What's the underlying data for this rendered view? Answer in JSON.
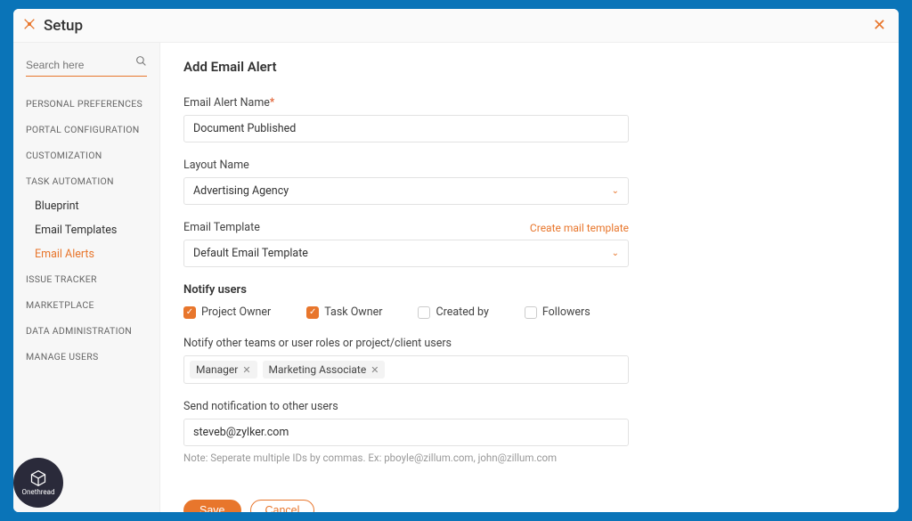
{
  "header": {
    "title": "Setup"
  },
  "sidebar": {
    "search_placeholder": "Search here",
    "sections": [
      "PERSONAL PREFERENCES",
      "PORTAL CONFIGURATION",
      "CUSTOMIZATION",
      "TASK AUTOMATION",
      "ISSUE TRACKER",
      "MARKETPLACE",
      "DATA ADMINISTRATION",
      "MANAGE USERS"
    ],
    "task_automation_subs": [
      "Blueprint",
      "Email Templates",
      "Email Alerts"
    ]
  },
  "page": {
    "title": "Add Email Alert",
    "alert_name_label": "Email Alert Name",
    "alert_name_value": "Document Published",
    "layout_label": "Layout Name",
    "layout_value": "Advertising Agency",
    "template_label": "Email Template",
    "create_template_link": "Create mail template",
    "template_value": "Default Email Template",
    "notify_title": "Notify users",
    "notify_options": [
      {
        "label": "Project Owner",
        "checked": true
      },
      {
        "label": "Task Owner",
        "checked": true
      },
      {
        "label": "Created by",
        "checked": false
      },
      {
        "label": "Followers",
        "checked": false
      }
    ],
    "notify_teams_label": "Notify other teams or user roles or project/client users",
    "notify_teams_tags": [
      "Manager",
      "Marketing Associate"
    ],
    "other_users_label": "Send notification to other users",
    "other_users_value": "steveb@zylker.com",
    "note_text": "Note: Seperate multiple IDs by commas. Ex: pboyle@zillum.com, john@zillum.com",
    "save_label": "Save",
    "cancel_label": "Cancel"
  },
  "brand": {
    "name": "Onethread"
  }
}
